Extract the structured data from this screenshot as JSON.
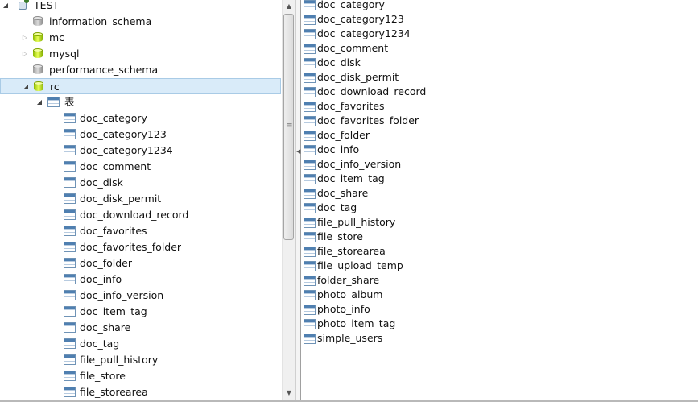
{
  "left_tree": {
    "connection": {
      "label": "TEST",
      "expanded": true,
      "icon": "connection-icon"
    },
    "databases": [
      {
        "label": "information_schema",
        "icon": "database-gray-icon",
        "expander": ""
      },
      {
        "label": "mc",
        "icon": "database-green-icon",
        "expander": "collapsed"
      },
      {
        "label": "mysql",
        "icon": "database-green-icon",
        "expander": "collapsed"
      },
      {
        "label": "performance_schema",
        "icon": "database-gray-icon",
        "expander": ""
      },
      {
        "label": "rc",
        "icon": "database-green-icon",
        "expander": "expanded",
        "selected": true
      }
    ],
    "tables_group": {
      "label": "表",
      "icon": "table-group-icon"
    },
    "tables": [
      "doc_category",
      "doc_category123",
      "doc_category1234",
      "doc_comment",
      "doc_disk",
      "doc_disk_permit",
      "doc_download_record",
      "doc_favorites",
      "doc_favorites_folder",
      "doc_folder",
      "doc_info",
      "doc_info_version",
      "doc_item_tag",
      "doc_share",
      "doc_tag",
      "file_pull_history",
      "file_store",
      "file_storearea"
    ]
  },
  "right_list": {
    "items": [
      "doc_category",
      "doc_category123",
      "doc_category1234",
      "doc_comment",
      "doc_disk",
      "doc_disk_permit",
      "doc_download_record",
      "doc_favorites",
      "doc_favorites_folder",
      "doc_folder",
      "doc_info",
      "doc_info_version",
      "doc_item_tag",
      "doc_share",
      "doc_tag",
      "file_pull_history",
      "file_store",
      "file_storearea",
      "file_upload_temp",
      "folder_share",
      "photo_album",
      "photo_info",
      "photo_item_tag",
      "simple_users"
    ]
  },
  "colors": {
    "selection_bg": "#d9ebf9",
    "selection_border": "#a9cbe6"
  }
}
